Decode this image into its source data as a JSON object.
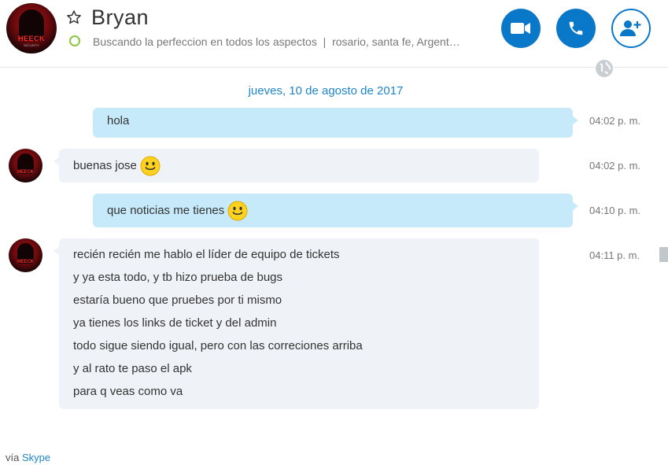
{
  "contact": {
    "name": "Bryan",
    "avatar_brand": "HEECK",
    "avatar_sub": "SECURITY",
    "mood_message": "Buscando la perfeccion en todos los aspectos",
    "separator": "|",
    "location": "rosario, santa fe, Argent…",
    "presence_color": "#8cc63f"
  },
  "header_actions": {
    "video_call_icon": "video-camera-icon",
    "audio_call_icon": "phone-icon",
    "add_people_icon": "add-person-icon",
    "favorite_icon": "star-icon"
  },
  "conversation": {
    "date_separator": "jueves, 10 de agosto de 2017",
    "messages": [
      {
        "direction": "outgoing",
        "lines": [
          "hola"
        ],
        "emoticon": false,
        "time": "04:02 p. m."
      },
      {
        "direction": "incoming",
        "lines": [
          "buenas jose"
        ],
        "emoticon": true,
        "time": "04:02 p. m."
      },
      {
        "direction": "outgoing",
        "lines": [
          "que noticias me tienes"
        ],
        "emoticon": true,
        "time": "04:10 p. m."
      },
      {
        "direction": "incoming",
        "lines": [
          "recién recién me hablo el líder de equipo de tickets",
          "y ya esta todo, y tb hizo prueba de bugs",
          "estaría bueno que pruebes por ti mismo",
          "ya tienes los links de ticket y del admin",
          "todo sigue siendo igual, pero con las correciones arriba",
          "y al rato te paso el apk",
          "para q veas como va"
        ],
        "emoticon": false,
        "time": "04:11 p. m."
      }
    ]
  },
  "footer": {
    "prefix": "vía",
    "link": "Skype"
  },
  "colors": {
    "accent": "#0a78c8",
    "outgoing_bubble": "#c7eafb",
    "incoming_bubble": "#eff2f6",
    "date_text": "#1f85c8"
  }
}
